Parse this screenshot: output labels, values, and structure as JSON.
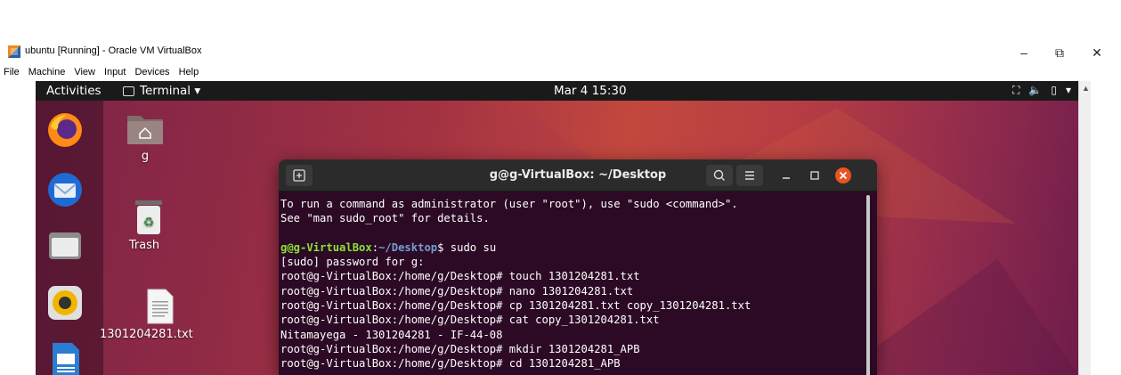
{
  "host": {
    "title": "ubuntu [Running] - Oracle VM VirtualBox",
    "menu": [
      "File",
      "Machine",
      "View",
      "Input",
      "Devices",
      "Help"
    ],
    "controls": {
      "minimize": "–",
      "restore": "⧉",
      "close": "✕"
    }
  },
  "topbar": {
    "activities": "Activities",
    "app_menu": "Terminal ▾",
    "clock": "Mar 4  15:30",
    "tray": {
      "network": "⛶",
      "volume": "🔈",
      "battery": "▯",
      "menu": "▾"
    }
  },
  "desktop": {
    "icons": [
      {
        "label": "g",
        "icon": "home-folder-icon"
      },
      {
        "label": "Trash",
        "icon": "trash-icon"
      },
      {
        "label": "1301204281.txt",
        "icon": "text-file-icon"
      }
    ]
  },
  "dock": [
    "firefox-icon",
    "thunderbird-icon",
    "files-icon",
    "rhythmbox-icon",
    "writer-icon"
  ],
  "terminal": {
    "title": "g@g-VirtualBox: ~/Desktop",
    "lines": {
      "l1": "To run a command as administrator (user \"root\"), use \"sudo <command>\".",
      "l2": "See \"man sudo_root\" for details.",
      "l3_user": "g@g-VirtualBox",
      "l3_colon": ":",
      "l3_path": "~/Desktop",
      "l3_rest": "$ sudo su",
      "l4": "[sudo] password for g:",
      "l5": "root@g-VirtualBox:/home/g/Desktop# touch 1301204281.txt",
      "l6": "root@g-VirtualBox:/home/g/Desktop# nano 1301204281.txt",
      "l7": "root@g-VirtualBox:/home/g/Desktop# cp 1301204281.txt copy_1301204281.txt",
      "l8": "root@g-VirtualBox:/home/g/Desktop# cat copy_1301204281.txt",
      "l9": "Nitamayega - 1301204281 - IF-44-08",
      "l10": "root@g-VirtualBox:/home/g/Desktop# mkdir 1301204281_APB",
      "l11": "root@g-VirtualBox:/home/g/Desktop# cd 1301204281_APB"
    }
  },
  "colors": {
    "prompt_user": "#8ae234",
    "prompt_path": "#729fcf",
    "terminal_bg": "#2c0a25",
    "close_button": "#e95420"
  }
}
